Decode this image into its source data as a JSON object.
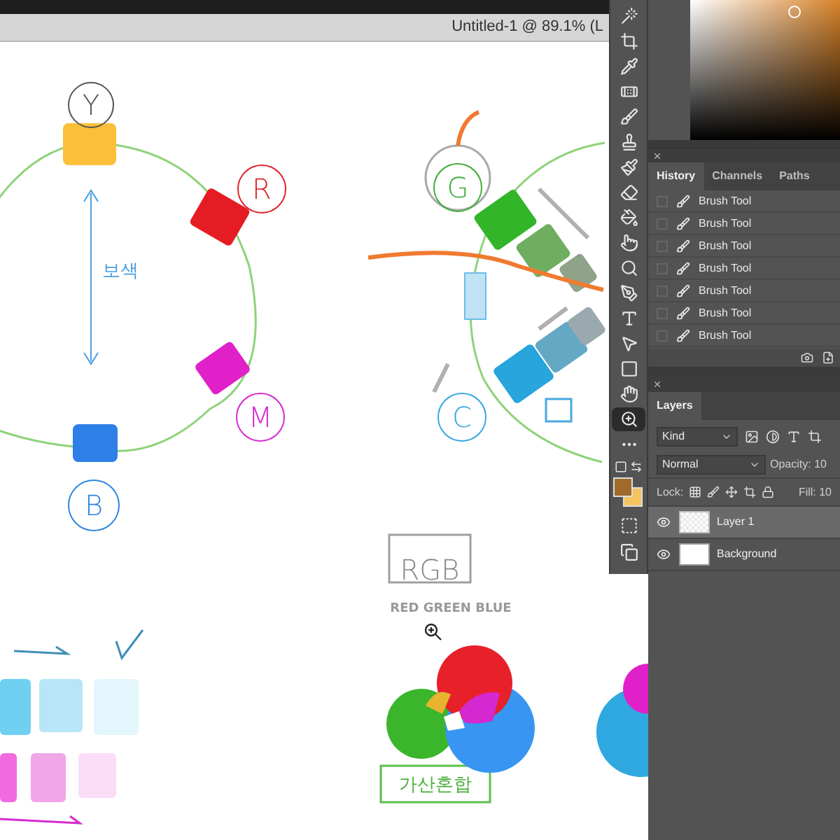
{
  "document": {
    "title": "Untitled-1 @ 89.1% (L"
  },
  "canvas": {
    "labels": [
      {
        "text": "Y",
        "color": "#555555"
      },
      {
        "text": "R",
        "color": "#e0242a"
      },
      {
        "text": "M",
        "color": "#d62ad0"
      },
      {
        "text": "B",
        "color": "#2f86e0"
      },
      {
        "text": "보색",
        "color": "#4a9ee0"
      },
      {
        "text": "G",
        "color": "#3fae3a"
      },
      {
        "text": "C",
        "color": "#35a8e0"
      },
      {
        "text": "RGB",
        "color": "#888888"
      },
      {
        "text": "RED GREEN BLUE",
        "color": "#999999"
      },
      {
        "text": "가산혼합",
        "color": "#4caf3c"
      }
    ]
  },
  "tools": [
    {
      "kind": "wand",
      "selected": false
    },
    {
      "kind": "crop",
      "selected": false
    },
    {
      "kind": "eyedropper",
      "selected": false
    },
    {
      "kind": "healing",
      "selected": false
    },
    {
      "kind": "brush",
      "selected": false
    },
    {
      "kind": "stamp",
      "selected": false
    },
    {
      "kind": "history-brush",
      "selected": false
    },
    {
      "kind": "eraser",
      "selected": false
    },
    {
      "kind": "bucket",
      "selected": false
    },
    {
      "kind": "smudge",
      "selected": false
    },
    {
      "kind": "dodge",
      "selected": false
    },
    {
      "kind": "pen",
      "selected": false
    },
    {
      "kind": "type",
      "selected": false
    },
    {
      "kind": "path-select",
      "selected": false
    },
    {
      "kind": "shape",
      "selected": false
    },
    {
      "kind": "hand",
      "selected": false
    },
    {
      "kind": "zoom",
      "selected": true
    },
    {
      "kind": "more",
      "selected": false
    }
  ],
  "swatches": [
    {
      "color": "#a06a2c"
    },
    {
      "color": "#f6c35e"
    }
  ],
  "history": {
    "tabs": [
      {
        "label": "History",
        "selected": true
      },
      {
        "label": "Channels",
        "selected": false
      },
      {
        "label": "Paths",
        "selected": false
      }
    ],
    "items": [
      {
        "label": "Brush Tool"
      },
      {
        "label": "Brush Tool"
      },
      {
        "label": "Brush Tool"
      },
      {
        "label": "Brush Tool"
      },
      {
        "label": "Brush Tool"
      },
      {
        "label": "Brush Tool"
      },
      {
        "label": "Brush Tool"
      }
    ]
  },
  "layers": {
    "tabs": [
      {
        "label": "Layers",
        "selected": true
      }
    ],
    "filter": "Kind",
    "blend_mode": "Normal",
    "opacity_label": "Opacity: 10",
    "lock_label": "Lock:",
    "fill_label": "Fill: 10",
    "items": [
      {
        "name": "Layer 1",
        "selected": true,
        "visible": true,
        "kind": "transparent"
      },
      {
        "name": "Background",
        "selected": false,
        "visible": true,
        "kind": "white"
      }
    ]
  }
}
